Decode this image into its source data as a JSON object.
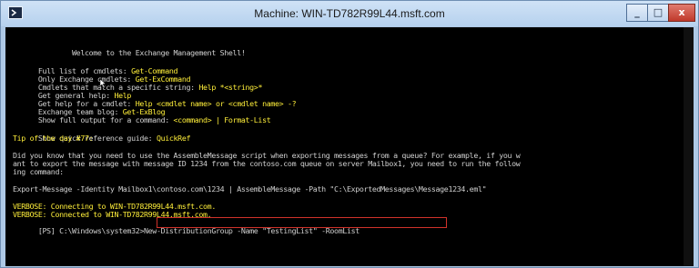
{
  "window": {
    "title": "Machine: WIN-TD782R99L44.msft.com",
    "controls": {
      "minimize": "_",
      "maximize": "□",
      "close": "x"
    }
  },
  "console": {
    "lines": [
      {
        "prefix": "        Welcome to the Exchange Management Shell!",
        "value": ""
      },
      {
        "prefix": "Full list of cmdlets: ",
        "value": "Get-Command"
      },
      {
        "prefix": "Only Exchange cmdlets: ",
        "value": "Get-ExCommand"
      },
      {
        "prefix": "Cmdlets that match a specific string: ",
        "value": "Help *<string>*"
      },
      {
        "prefix": "Get general help: ",
        "value": "Help"
      },
      {
        "prefix": "Get help for a cmdlet: ",
        "value": "Help <cmdlet name> or <cmdlet name> -?"
      },
      {
        "prefix": "Exchange team blog: ",
        "value": "Get-ExBlog"
      },
      {
        "prefix": "Show full output for a command: ",
        "value": "<command> | Format-List"
      },
      {
        "prefix": "Show quick reference guide: ",
        "value": "QuickRef"
      },
      {
        "prefix": "Tip of the day #77:",
        "value": ""
      },
      {
        "prefix": "Did you know that you need to use the AssembleMessage script when exporting messages from a queue? For example, if you w",
        "value": ""
      },
      {
        "prefix": "ant to export the message with message ID 1234 from the contoso.com queue on server Mailbox1, you need to run the follow",
        "value": ""
      },
      {
        "prefix": "ing command:",
        "value": ""
      },
      {
        "prefix": "Export-Message -Identity Mailbox1\\contoso.com\\1234 | AssembleMessage -Path \"C:\\ExportedMessages\\Message1234.eml\"",
        "value": ""
      },
      {
        "prefix": "VERBOSE: Connecting to WIN-TD782R99L44.msft.com.",
        "value": ""
      },
      {
        "prefix": "VERBOSE: Connected to WIN-TD782R99L44.msft.com.",
        "value": ""
      },
      {
        "prefix": "[PS] C:\\Windows\\system32>",
        "value": "New-DistributionGroup -Name \"TestingList\" -RoomList"
      }
    ]
  }
}
